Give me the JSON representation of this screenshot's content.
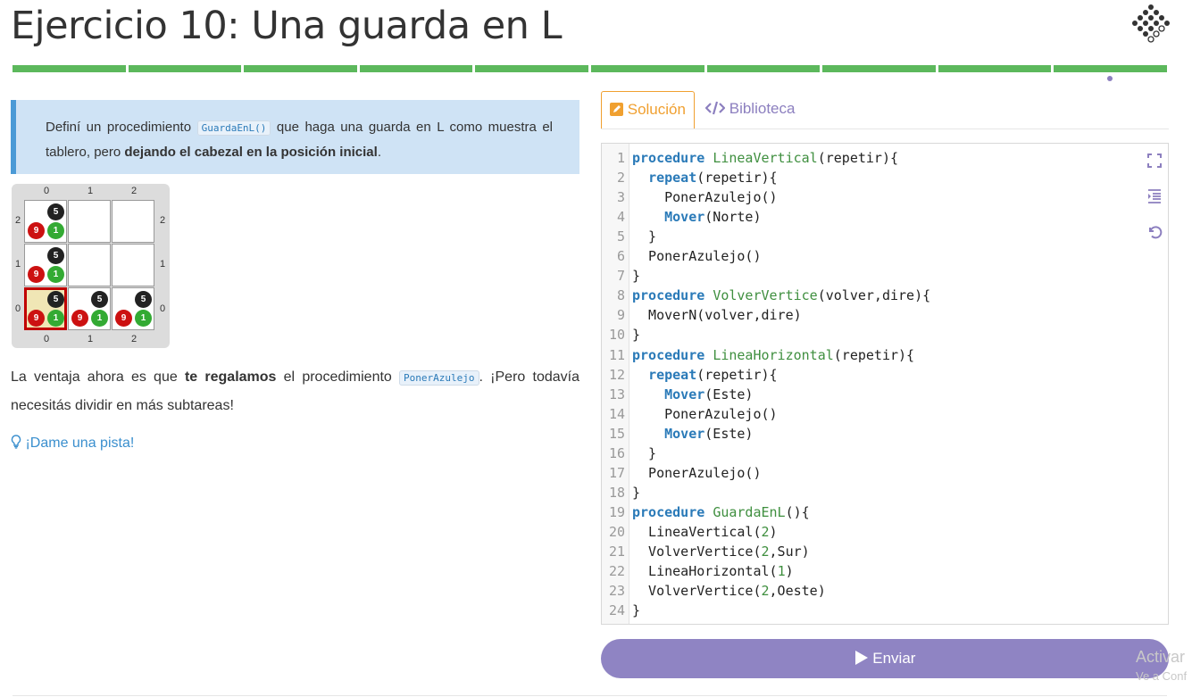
{
  "header": {
    "title": "Ejercicio 10: Una guarda en L",
    "logo_icon": "gobstones-logo-icon",
    "progress_segments": 10,
    "progress_color": "#5cb85c"
  },
  "statement": {
    "p1_a": "Definí un procedimiento ",
    "p1_code": "GuardaEnL()",
    "p1_b": " que haga una guarda en L como muestra el tablero, pero ",
    "p1_bold": "dejando el cabezal en la posición inicial",
    "p1_c": ".",
    "p2_a": "La ventaja ahora es que ",
    "p2_bold": "te regalamos",
    "p2_b": " el procedimiento ",
    "p2_code": "PonerAzulejo",
    "p2_c": ". ¡Pero todavía necesitás dividir en más subtareas!",
    "hint": "¡Dame una pista!"
  },
  "board": {
    "col_labels": [
      "0",
      "1",
      "2"
    ],
    "row_labels": [
      "2",
      "1",
      "0"
    ],
    "cells": [
      {
        "row": 2,
        "col": 0,
        "black": "5",
        "red": "9",
        "green": "1"
      },
      {
        "row": 1,
        "col": 0,
        "black": "5",
        "red": "9",
        "green": "1"
      },
      {
        "row": 0,
        "col": 0,
        "black": "5",
        "red": "9",
        "green": "1",
        "head": true
      },
      {
        "row": 0,
        "col": 1,
        "black": "5",
        "red": "9",
        "green": "1"
      },
      {
        "row": 0,
        "col": 2,
        "black": "5",
        "red": "9",
        "green": "1"
      }
    ]
  },
  "tabs": {
    "solution": "Solución",
    "library": "Biblioteca"
  },
  "editor": {
    "lines": [
      "procedure LineaVertical(repetir){",
      "  repeat(repetir){",
      "    PonerAzulejo()",
      "    Mover(Norte)",
      "  }",
      "  PonerAzulejo()",
      "}",
      "procedure VolverVertice(volver,dire){",
      "  MoverN(volver,dire)",
      "}",
      "procedure LineaHorizontal(repetir){",
      "  repeat(repetir){",
      "    Mover(Este)",
      "    PonerAzulejo()",
      "    Mover(Este)",
      "  }",
      "  PonerAzulejo()",
      "}",
      "procedure GuardaEnL(){",
      "  LineaVertical(2)",
      "  VolverVertice(2,Sur)",
      "  LineaHorizontal(1)",
      "  VolverVertice(2,Oeste)",
      "}"
    ],
    "tool_icons": [
      "fullscreen-icon",
      "indent-icon",
      "undo-icon"
    ]
  },
  "submit_label": "Enviar",
  "watermark": {
    "line1": "Activar",
    "line2": "Ve a Conf"
  }
}
